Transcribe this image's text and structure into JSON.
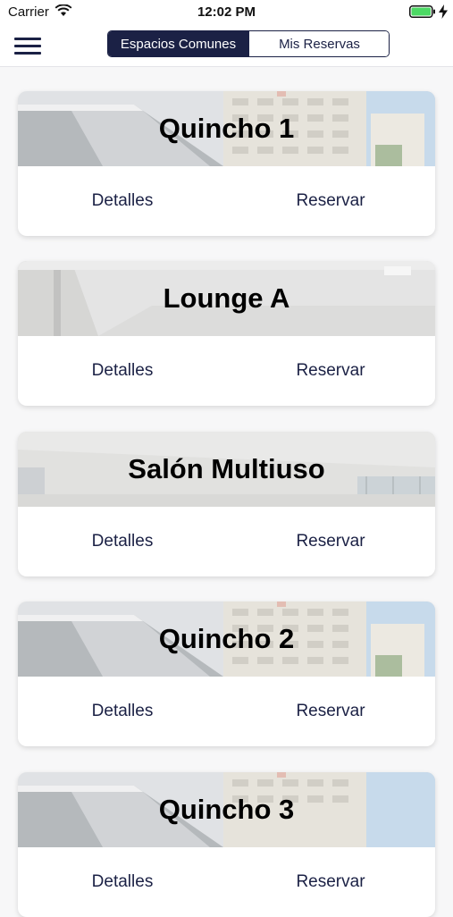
{
  "status_bar": {
    "carrier": "Carrier",
    "time": "12:02 PM"
  },
  "nav": {
    "segments": [
      "Espacios Comunes",
      "Mis Reservas"
    ],
    "active_segment": "Espacios Comunes"
  },
  "spaces": [
    {
      "name": "Quincho 1",
      "details_label": "Detalles",
      "reserve_label": "Reservar",
      "image": "building-exterior"
    },
    {
      "name": "Lounge A",
      "details_label": "Detalles",
      "reserve_label": "Reservar",
      "image": "lounge-interior"
    },
    {
      "name": "Salón Multiuso",
      "details_label": "Detalles",
      "reserve_label": "Reservar",
      "image": "hall-interior"
    },
    {
      "name": "Quincho 2",
      "details_label": "Detalles",
      "reserve_label": "Reservar",
      "image": "building-exterior"
    },
    {
      "name": "Quincho 3",
      "details_label": "Detalles",
      "reserve_label": "Reservar",
      "image": "building-exterior"
    }
  ],
  "colors": {
    "primary": "#1b2145",
    "background": "#f7f7f8",
    "battery": "#4cd964"
  }
}
